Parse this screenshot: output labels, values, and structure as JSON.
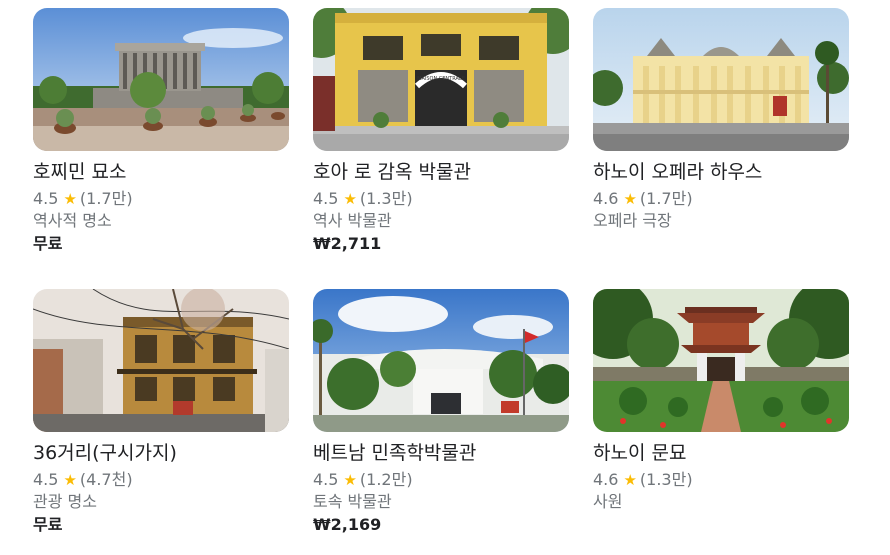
{
  "places": [
    {
      "title": "호찌민 묘소",
      "rating": "4.5",
      "reviews": "(1.7만)",
      "category": "역사적 명소",
      "price": "무료",
      "image": "ho-chi-minh-mausoleum-photo"
    },
    {
      "title": "호아 로 감옥 박물관",
      "rating": "4.5",
      "reviews": "(1.3만)",
      "category": "역사 박물관",
      "price": "₩2,711",
      "image": "hoa-lo-prison-photo"
    },
    {
      "title": "하노이 오페라 하우스",
      "rating": "4.6",
      "reviews": "(1.7만)",
      "category": "오페라 극장",
      "price": "",
      "image": "opera-house-photo"
    },
    {
      "title": "36거리(구시가지)",
      "rating": "4.5",
      "reviews": "(4.7천)",
      "category": "관광 명소",
      "price": "무료",
      "image": "old-quarter-photo"
    },
    {
      "title": "베트남 민족학박물관",
      "rating": "4.5",
      "reviews": "(1.2만)",
      "category": "토속 박물관",
      "price": "₩2,169",
      "image": "ethnology-museum-photo"
    },
    {
      "title": "하노이 문묘",
      "rating": "4.6",
      "reviews": "(1.3만)",
      "category": "사원",
      "price": "",
      "image": "temple-of-literature-photo"
    }
  ],
  "sign_text": "MAISON CENTRALE",
  "colors": {
    "star": "#fbbc04",
    "title": "#202124",
    "secondary": "#70757a"
  },
  "icons": {
    "rating": "star-icon"
  }
}
